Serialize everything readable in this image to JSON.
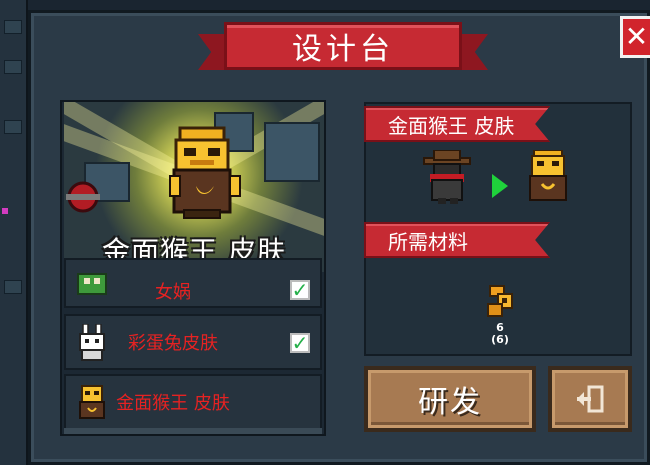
{
  "title": "设计台",
  "close_icon": "close-icon",
  "preview": {
    "item_name": "金面猴王 皮肤"
  },
  "list": [
    {
      "label": "女娲",
      "checked": true,
      "icon": "nuwa-skin-icon"
    },
    {
      "label": "彩蛋兔皮肤",
      "checked": true,
      "icon": "easter-bunny-skin-icon"
    },
    {
      "label": "金面猴王  皮肤",
      "checked": false,
      "icon": "golden-monkey-king-skin-icon"
    }
  ],
  "recipe": {
    "result_title": "金面猴王  皮肤",
    "materials_title": "所需材料",
    "material": {
      "icon": "material-part-icon",
      "count": "6",
      "owned": "(6)"
    }
  },
  "buttons": {
    "research": "研发",
    "exit_icon": "exit-door-icon"
  },
  "colors": {
    "ribbon_red": "#c62a33",
    "item_label_red": "#e62222",
    "button_brown": "#a77a52",
    "check_green": "#25b04a",
    "arrow_green": "#1fd23b"
  }
}
